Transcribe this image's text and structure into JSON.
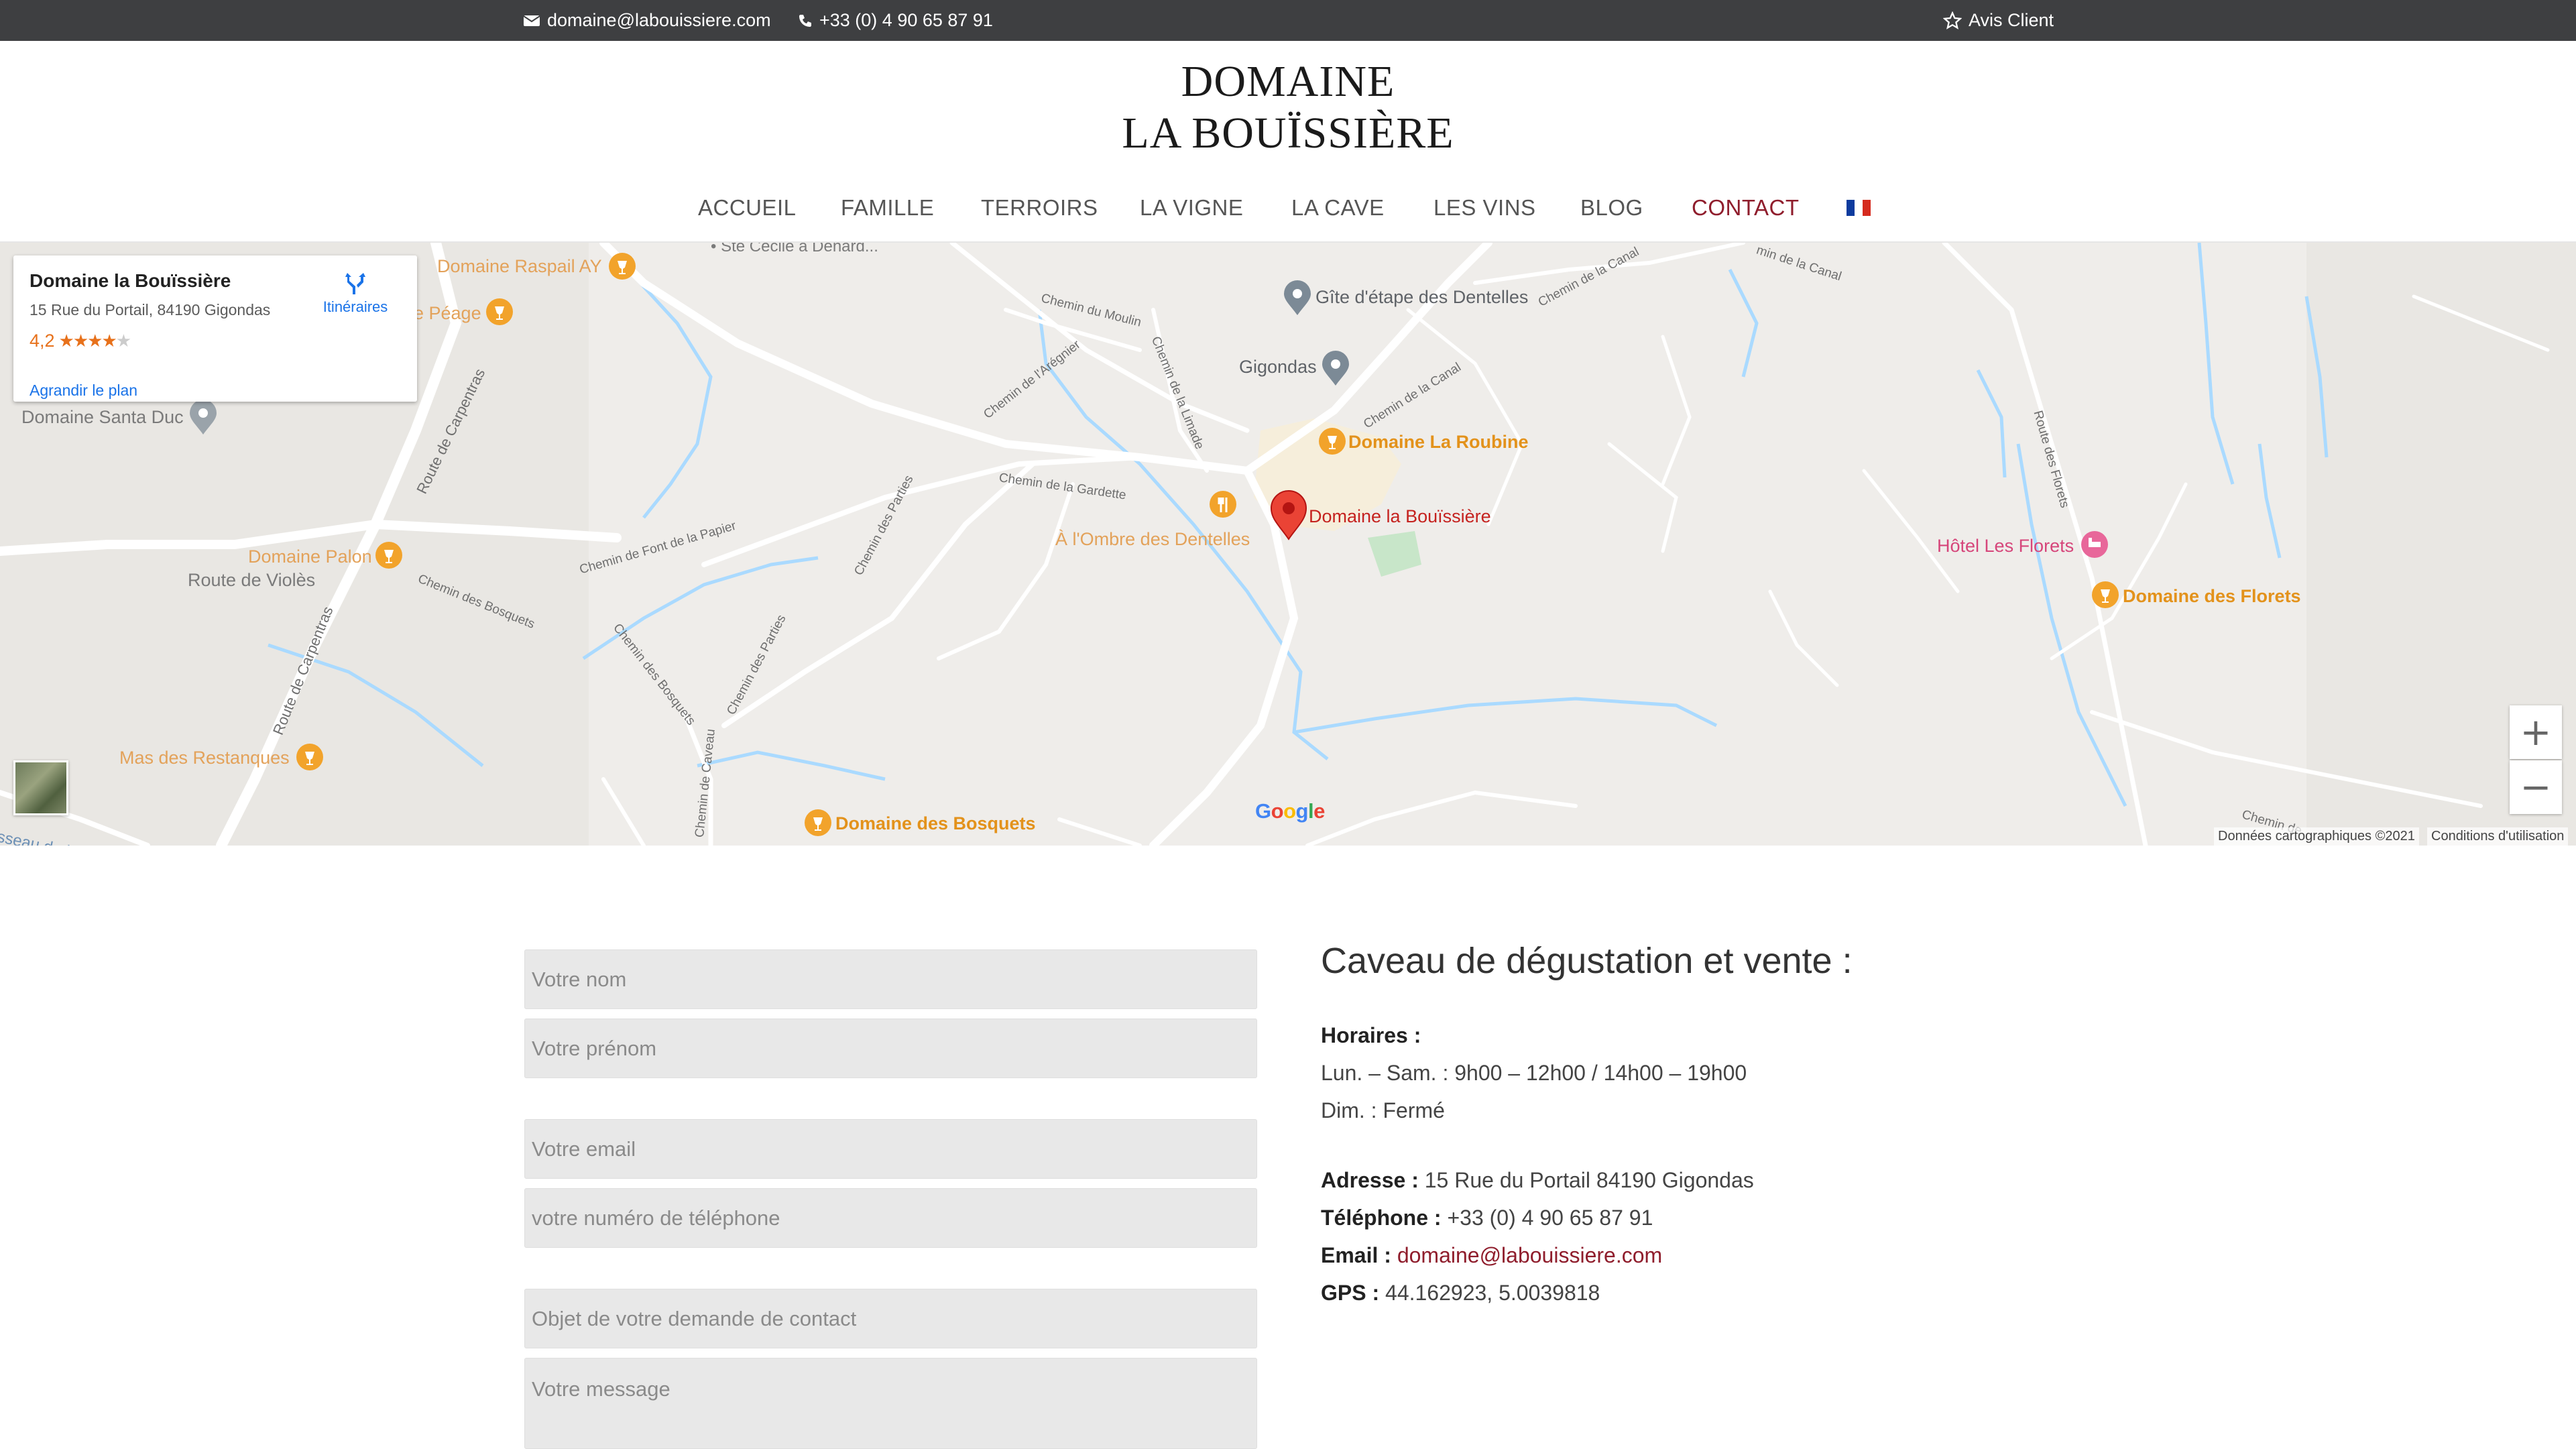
{
  "topbar": {
    "email": "domaine@labouissiere.com",
    "phone": "+33 (0) 4 90 65 87 91",
    "reviews": "Avis Client"
  },
  "logo": {
    "line1": "DOMAINE",
    "line2": "LA BOUÏSSIÈRE"
  },
  "nav": {
    "items": [
      {
        "label": "ACCUEIL"
      },
      {
        "label": "FAMILLE"
      },
      {
        "label": "TERROIRS"
      },
      {
        "label": "LA VIGNE"
      },
      {
        "label": "LA CAVE"
      },
      {
        "label": "LES VINS"
      },
      {
        "label": "BLOG"
      },
      {
        "label": "CONTACT"
      }
    ],
    "active": "CONTACT",
    "active_color": "#8f1d2c",
    "language_flag": "fr-flag-icon"
  },
  "map": {
    "card": {
      "title": "Domaine la Bouïssière",
      "address": "15 Rue du Portail, 84190 Gigondas",
      "rating": "4,2",
      "stars": 4.2,
      "directions": "Itinéraires",
      "enlarge": "Agrandir le plan"
    },
    "places": {
      "raspail": "Domaine Raspail AY",
      "peage": "e Péage",
      "santa_duc": "Domaine Santa Duc",
      "palon": "Domaine Palon",
      "violes": "Route de Violès",
      "restanques": "Mas des Restanques",
      "bosquets": "Domaine des Bosquets",
      "gite": "Gîte d'étape des Dentelles",
      "gigondas": "Gigondas",
      "roubine": "Domaine La Roubine",
      "bouissiere": "Domaine la Bouïssière",
      "ombre": "À l'Ombre des Dentelles",
      "florets_hotel": "Hôtel Les Florets",
      "florets": "Domaine des Florets",
      "partial_top": "• Ste Cécile à Denard...",
      "partial_bottom": "sseau de la"
    },
    "roads": {
      "moulin": "Chemin du Moulin",
      "aregnier": "Chemin de l'Arégnier",
      "limade": "Chemin de la Limade",
      "canal1": "Chemin de la Canal",
      "canal2": "Chemin de la Canal",
      "canal3": "min de la Canal",
      "gardette": "Chemin de la Gardette",
      "font_papier": "Chemin de Font de la Papier",
      "parties1": "Chemin des Parties",
      "parties2": "Chemin des Parties",
      "bosquets1": "Chemin des Bosquets",
      "bosquets2": "Chemin des Bosquets",
      "caveau": "Chemin de Caveau",
      "carpentras1": "Route de Carpentras",
      "carpentras2": "Route de Carpentras",
      "florets_road": "Route des Florets",
      "chemin_right": "Chemin de"
    },
    "google": "Google",
    "footer_data": "Données cartographiques ©2021",
    "footer_terms": "Conditions d'utilisation",
    "zoom_in": "+",
    "zoom_out": "−"
  },
  "form": {
    "name": "Votre nom",
    "firstname": "Votre prénom",
    "email": "Votre email",
    "phone": "votre numéro de téléphone",
    "subject": "Objet de votre demande de contact",
    "message": "Votre message"
  },
  "info": {
    "title": "Caveau de dégustation et vente :",
    "hours_label": "Horaires :",
    "hours_week": "Lun. – Sam. : 9h00 – 12h00 / 14h00 – 19h00",
    "hours_sunday": "Dim. : Fermé",
    "address_label": "Adresse :",
    "address_value": "15 Rue du Portail 84190 Gigondas",
    "phone_label": "Téléphone :",
    "phone_value": "+33 (0) 4 90 65 87 91",
    "email_label": "Email :",
    "email_value": "domaine@labouissiere.com",
    "gps_label": "GPS :",
    "gps_value": "44.162923, 5.0039818"
  },
  "colors": {
    "topbar_bg": "#3e3f41",
    "accent": "#8f1d2c",
    "map_orange": "#e3921b",
    "map_pin_red": "#ea4335"
  }
}
